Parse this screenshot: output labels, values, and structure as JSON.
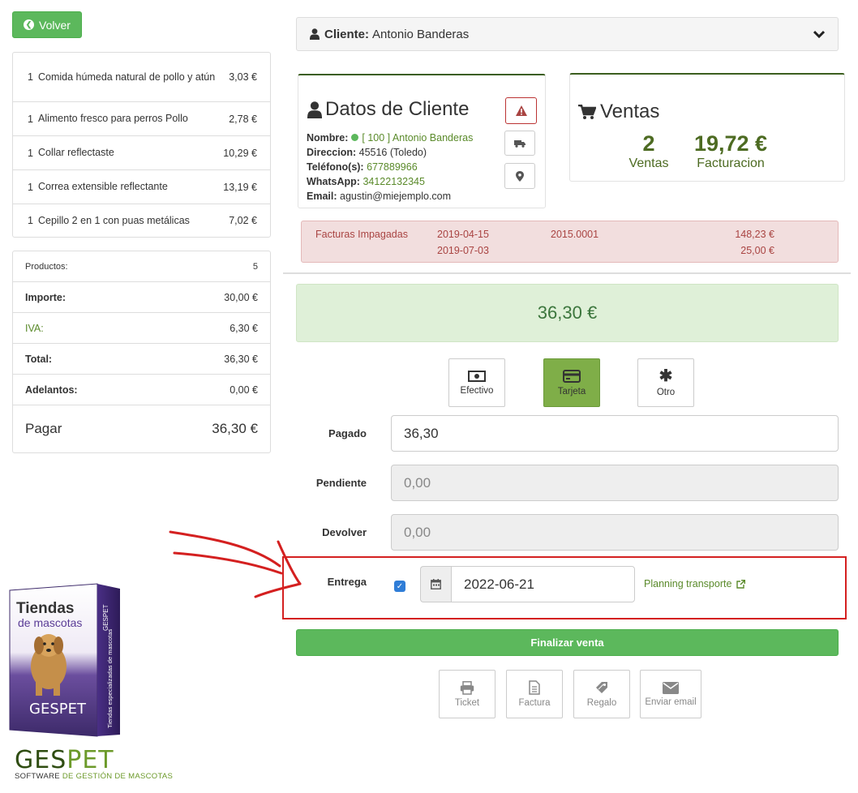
{
  "back_button": {
    "label": "Volver"
  },
  "products": [
    {
      "qty": "1",
      "name": "Comida húmeda natural de pollo y atún",
      "price": "3,03 €"
    },
    {
      "qty": "1",
      "name": "Alimento fresco para perros Pollo",
      "price": "2,78 €"
    },
    {
      "qty": "1",
      "name": "Collar reflectaste",
      "price": "10,29 €"
    },
    {
      "qty": "1",
      "name": "Correa extensible reflectante",
      "price": "13,19 €"
    },
    {
      "qty": "1",
      "name": "Cepillo 2 en 1 con puas metálicas",
      "price": "7,02 €"
    }
  ],
  "totals": {
    "productos_label": "Productos:",
    "productos_value": "5",
    "importe_label": "Importe:",
    "importe_value": "30,00 €",
    "iva_label": "IVA:",
    "iva_value": "6,30 €",
    "total_label": "Total:",
    "total_value": "36,30 €",
    "adelantos_label": "Adelantos:",
    "adelantos_value": "0,00 €",
    "pagar_label": "Pagar",
    "pagar_value": "36,30 €"
  },
  "client_bar": {
    "label": "Cliente:",
    "name": "Antonio Banderas"
  },
  "client_data": {
    "title": "Datos de Cliente",
    "nombre_label": "Nombre:",
    "nombre_value": "[ 100 ] Antonio Banderas",
    "direccion_label": "Direccion:",
    "direccion_value": "45516  (Toledo)",
    "telefono_label": "Teléfono(s):",
    "telefono_value": "677889966",
    "whatsapp_label": "WhatsApp:",
    "whatsapp_value": "34122132345",
    "email_label": "Email:",
    "email_value": "agustin@miejemplo.com"
  },
  "ventas": {
    "title": "Ventas",
    "count": "2",
    "count_label": "Ventas",
    "facturacion": "19,72 €",
    "facturacion_label": "Facturacion"
  },
  "unpaid": {
    "label": "Facturas Impagadas",
    "rows": [
      {
        "date": "2019-04-15",
        "number": "2015.0001",
        "amount": "148,23 €"
      },
      {
        "date": "2019-07-03",
        "number": "",
        "amount": "25,00 €"
      }
    ]
  },
  "total_due": "36,30 €",
  "payment_methods": [
    {
      "label": "Efectivo",
      "icon": "money-icon",
      "active": false
    },
    {
      "label": "Tarjeta",
      "icon": "credit-card-icon",
      "active": true
    },
    {
      "label": "Otro",
      "icon": "asterisk-icon",
      "active": false
    }
  ],
  "form": {
    "pagado_label": "Pagado",
    "pagado_value": "36,30",
    "pendiente_label": "Pendiente",
    "pendiente_value": "0,00",
    "devolver_label": "Devolver",
    "devolver_value": "0,00",
    "entrega_label": "Entrega",
    "entrega_checked": true,
    "entrega_date": "2022-06-21",
    "planning_link": "Planning transporte"
  },
  "finalizar_label": "Finalizar venta",
  "actions": [
    {
      "label": "Ticket",
      "icon": "printer-icon"
    },
    {
      "label": "Factura",
      "icon": "document-icon"
    },
    {
      "label": "Regalo",
      "icon": "gift-tag-icon"
    },
    {
      "label": "Enviar email",
      "icon": "envelope-icon"
    }
  ],
  "branding": {
    "box_title_1": "Tiendas",
    "box_title_2": "de mascotas",
    "box_side": "Tiendas especializadas de mascotas",
    "box_brand": "GESPET",
    "logo_a": "GES",
    "logo_b": "PET",
    "logo_sub_a": "SOFTWARE",
    "logo_sub_b": "DE GESTIÓN DE MASCOTAS"
  },
  "colors": {
    "accent_green": "#5cb85c",
    "dark_green": "#3b5e1e",
    "danger": "#a94442",
    "highlight_red": "#d42020"
  }
}
